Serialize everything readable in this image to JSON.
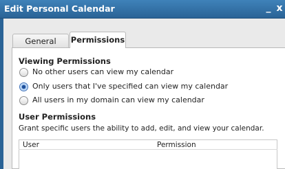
{
  "window": {
    "title": "Edit Personal Calendar",
    "minimize_glyph": "_",
    "close_glyph": "x"
  },
  "tabs": [
    {
      "label": "General",
      "selected": false
    },
    {
      "label": "Permissions",
      "selected": true
    }
  ],
  "viewing_permissions": {
    "heading": "Viewing Permissions",
    "options": [
      {
        "label": "No other users can view my calendar",
        "selected": false
      },
      {
        "label": "Only users that I've specified can view my calendar",
        "selected": true
      },
      {
        "label": "All users in my domain can view my calendar",
        "selected": false
      }
    ]
  },
  "user_permissions": {
    "heading": "User Permissions",
    "description": "Grant specific users the ability to add, edit, and view your calendar.",
    "columns": [
      "User",
      "Permission"
    ]
  },
  "colors": {
    "titlebar": "#2a6396",
    "accent_radio": "#3c6fb7"
  }
}
